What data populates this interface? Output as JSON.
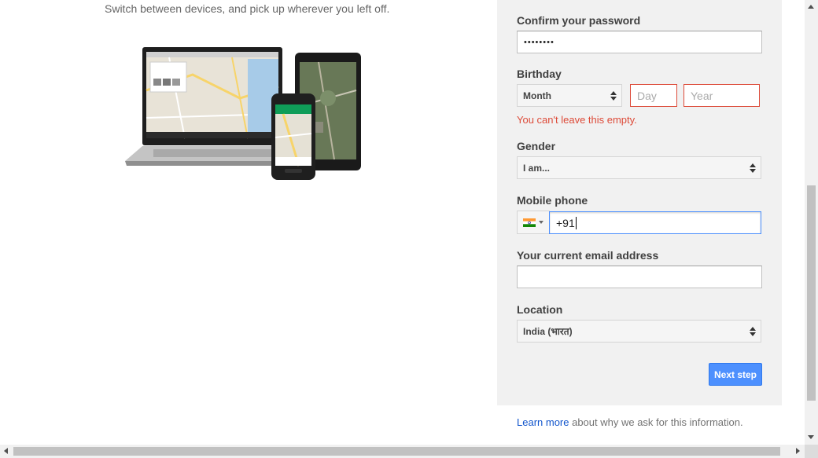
{
  "intro": {
    "tagline": "Switch between devices, and pick up wherever you left off."
  },
  "form": {
    "confirm_password": {
      "label": "Confirm your password",
      "value": "••••••••"
    },
    "birthday": {
      "label": "Birthday",
      "month": "Month",
      "day_placeholder": "Day",
      "year_placeholder": "Year",
      "error": "You can't leave this empty."
    },
    "gender": {
      "label": "Gender",
      "value": "I am..."
    },
    "mobile_phone": {
      "label": "Mobile phone",
      "value": "+91",
      "flag": "india-flag-icon"
    },
    "email": {
      "label": "Your current email address",
      "value": ""
    },
    "location": {
      "label": "Location",
      "value": "India (भारत)"
    },
    "next_button": "Next step"
  },
  "footer": {
    "learn_more": "Learn more",
    "rest": " about why we ask for this information."
  },
  "colors": {
    "primary_button": "#4d90fe",
    "error": "#dd4b39",
    "link": "#1155cc",
    "panel_bg": "#f1f1f1"
  }
}
